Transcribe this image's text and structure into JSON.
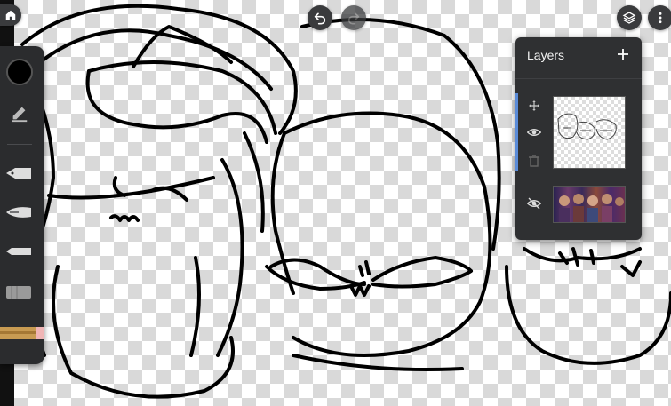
{
  "app": {
    "top_controls": {
      "home": "home-icon",
      "undo": "undo-icon",
      "redo": "redo-icon",
      "layers_toggle": "layers-icon",
      "more": "more-vert-icon"
    },
    "toolbar": {
      "color_swatch": "#000000",
      "tools": [
        "color-swatch",
        "edit-pen-icon",
        "ink-pen-icon",
        "fountain-pen-icon",
        "marker-icon",
        "eraser-icon",
        "pencil-icon"
      ]
    },
    "layers_panel": {
      "title": "Layers",
      "add_icon": "plus-icon",
      "layers": [
        {
          "name": "sketch-layer",
          "visible": true,
          "selected": true,
          "icons": [
            "move-icon",
            "eye-icon",
            "trash-icon"
          ]
        },
        {
          "name": "photo-layer",
          "visible": false,
          "selected": false,
          "icons": [
            "eye-off-icon"
          ]
        }
      ]
    },
    "colors": {
      "panel_bg": "#2f3032",
      "toolbar_bg": "#2b2c2e",
      "button_bg": "#3a3b3d",
      "selection_accent": "#5a8bd8"
    }
  }
}
